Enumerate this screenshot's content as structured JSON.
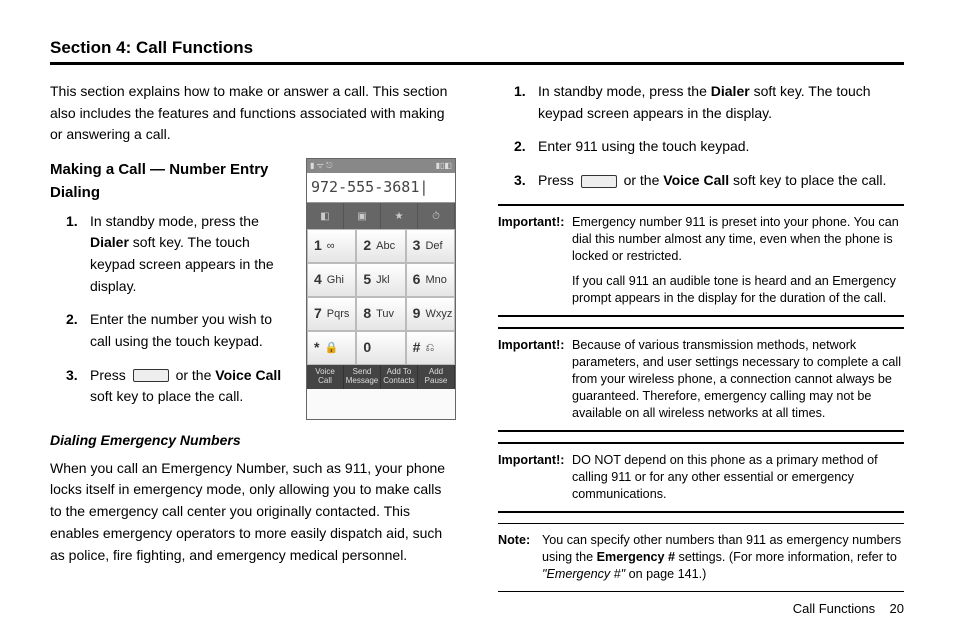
{
  "section_title": "Section 4: Call Functions",
  "left": {
    "intro": "This section explains how to make or answer a call. This section also includes the features and functions associated with making or answering a call.",
    "making_heading": "Making a Call — Number Entry Dialing",
    "steps": {
      "s1_a": "In standby mode, press the ",
      "s1_dialer": "Dialer",
      "s1_b": " soft key. The touch keypad screen appears in the display.",
      "s2": "Enter the number you wish to call using the touch keypad.",
      "s3_a": "Press ",
      "s3_b": " or the ",
      "s3_voice": "Voice Call",
      "s3_c": " soft key to place the call."
    },
    "emergency_heading": "Dialing Emergency Numbers",
    "emergency_body": "When you call an Emergency Number, such as 911, your phone locks itself in emergency mode, only allowing you to make calls to the emergency call center you originally contacted. This enables emergency operators to more easily dispatch aid, such as police, fire fighting, and emergency medical personnel."
  },
  "right": {
    "steps": {
      "s1_a": "In standby mode, press the ",
      "s1_dialer": "Dialer",
      "s1_b": " soft key. The touch keypad screen appears in the display.",
      "s2": "Enter 911 using the touch keypad.",
      "s3_a": "Press ",
      "s3_b": " or the ",
      "s3_voice": "Voice Call",
      "s3_c": " soft key to place the call."
    },
    "imp1_label": "Important!:",
    "imp1_a": "Emergency number 911 is preset into your phone. You can dial this number almost any time, even when the phone is locked or restricted.",
    "imp1_b": "If you call 911 an audible tone is heard and an Emergency prompt appears in the display for the duration of the call.",
    "imp2_label": "Important!:",
    "imp2": "Because of various transmission methods, network parameters, and user settings necessary to complete a call from your wireless phone, a connection cannot always be guaranteed. Therefore, emergency calling may not be available on all wireless networks at all times.",
    "imp3_label": "Important!:",
    "imp3": "DO NOT depend on this phone as a primary method of calling 911 or for any other essential or emergency communications.",
    "note_label": "Note:",
    "note_a": "You can specify other numbers than 911 as emergency numbers using the ",
    "note_b": "Emergency #",
    "note_c": " settings. (For more information, refer to ",
    "note_d": "\"Emergency #\"",
    "note_e": " on page 141.)"
  },
  "phone": {
    "number": "972-555-3681|",
    "tabs": [
      "◧",
      "▣",
      "★",
      "⏱"
    ],
    "keys": [
      {
        "n": "1",
        "l": "∞"
      },
      {
        "n": "2",
        "l": "Abc"
      },
      {
        "n": "3",
        "l": "Def"
      },
      {
        "n": "4",
        "l": "Ghi"
      },
      {
        "n": "5",
        "l": "Jkl"
      },
      {
        "n": "6",
        "l": "Mno"
      },
      {
        "n": "7",
        "l": "Pqrs"
      },
      {
        "n": "8",
        "l": "Tuv"
      },
      {
        "n": "9",
        "l": "Wxyz"
      },
      {
        "n": "*",
        "l": "🔒"
      },
      {
        "n": "0",
        "l": ""
      },
      {
        "n": "#",
        "l": "⎌"
      }
    ],
    "soft": [
      "Voice Call",
      "Send Message",
      "Add To Contacts",
      "Add Pause"
    ]
  },
  "footer": {
    "label": "Call Functions",
    "page": "20"
  }
}
